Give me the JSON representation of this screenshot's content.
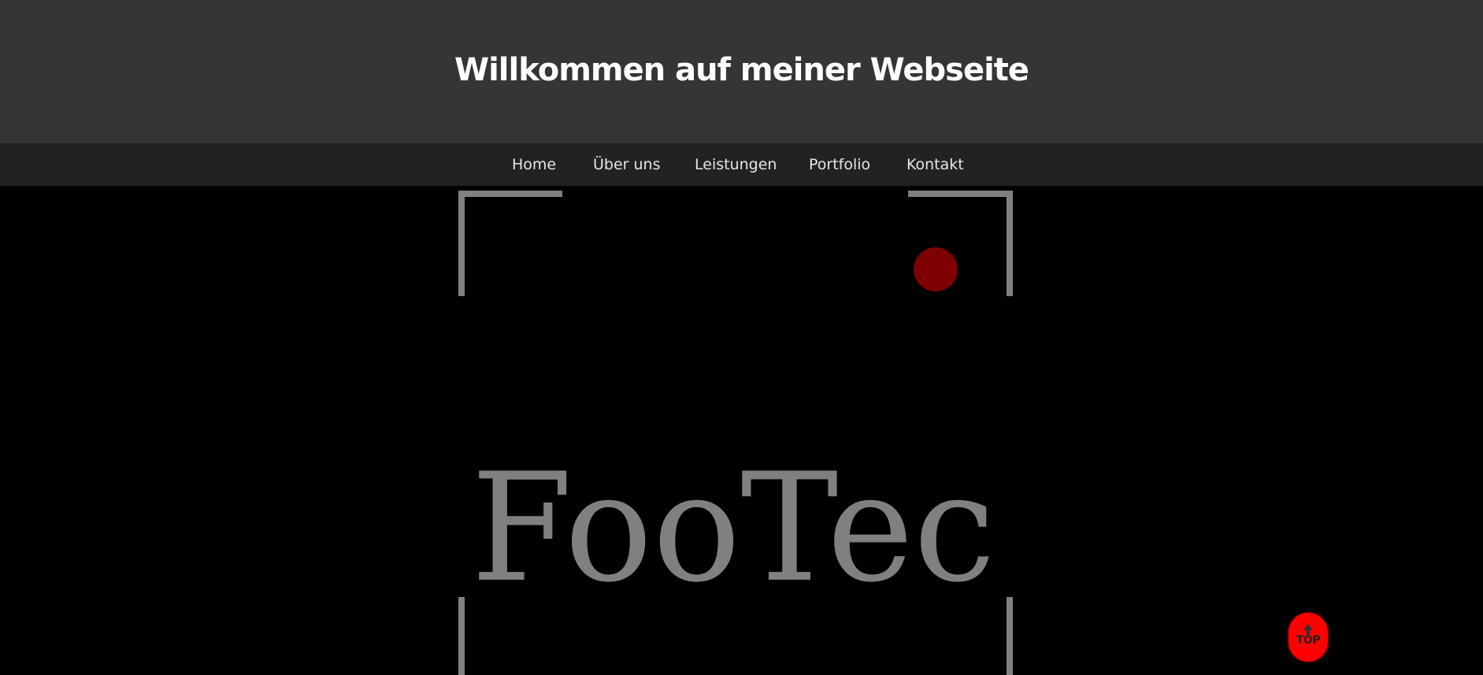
{
  "header": {
    "title": "Willkommen auf meiner Webseite"
  },
  "nav": {
    "items": [
      {
        "label": "Home"
      },
      {
        "label": "Über uns"
      },
      {
        "label": "Leistungen"
      },
      {
        "label": "Portfolio"
      },
      {
        "label": "Kontakt"
      }
    ]
  },
  "hero": {
    "logo_text": "FooTec",
    "logo_text_color": "#808080",
    "frame_color": "#808080",
    "dot_color": "#7f0000"
  },
  "scroll_top": {
    "label": "TOP",
    "icon": "up-arrow-icon",
    "color": "#ff0000"
  },
  "colors": {
    "header_bg": "#353535",
    "nav_bg": "#222222",
    "hero_bg": "#000000"
  }
}
